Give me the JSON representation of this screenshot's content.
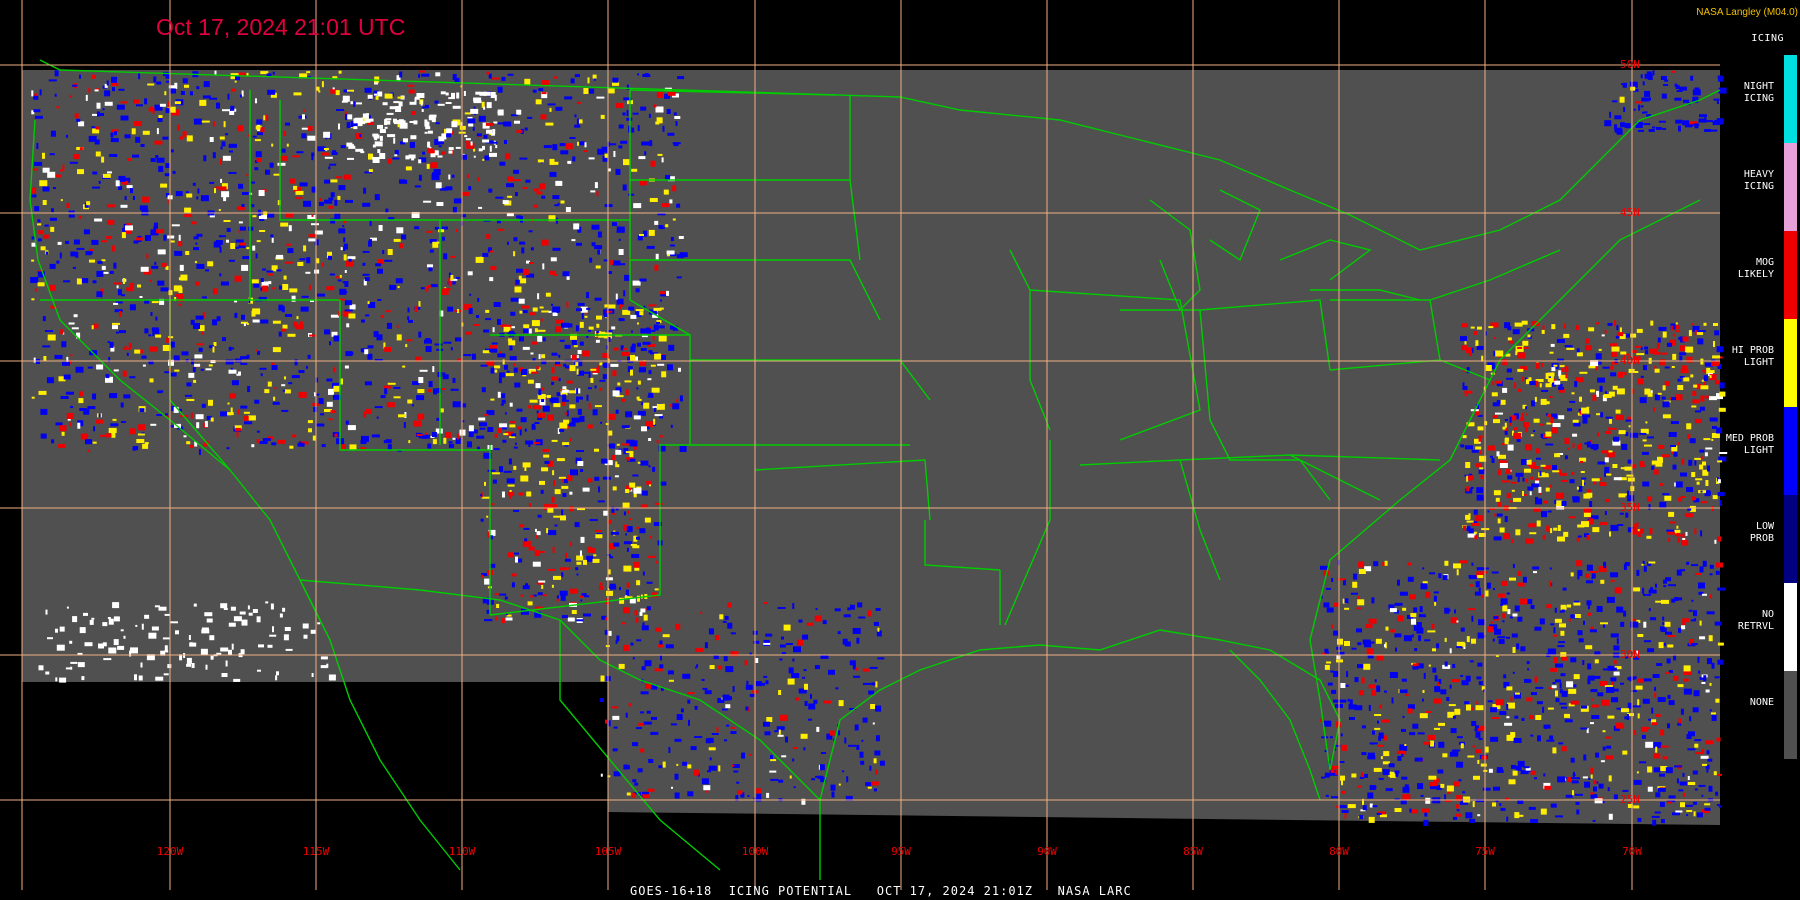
{
  "header": {
    "timestamp": "Oct 17, 2024 21:01 UTC",
    "credit": "NASA Langley (M04.0)"
  },
  "footer": {
    "product_title": "GOES-16+18  ICING POTENTIAL   OCT 17, 2024 21:01Z   NASA LARC"
  },
  "legend": {
    "title": "ICING",
    "items": [
      {
        "label": "NIGHT\nICING",
        "color": "#00e0e0"
      },
      {
        "label": "HEAVY\nICING",
        "color": "#e8a0d8"
      },
      {
        "label": "MOG\nLIKELY",
        "color": "#ee0000"
      },
      {
        "label": "HI PROB\nLIGHT",
        "color": "#ffff00"
      },
      {
        "label": "MED PROB\nLIGHT",
        "color": "#0000ff"
      },
      {
        "label": "LOW\nPROB",
        "color": "#000080"
      },
      {
        "label": "NO\nRETRVL",
        "color": "#ffffff"
      },
      {
        "label": "NONE",
        "color": "#505050"
      }
    ]
  },
  "graticule": {
    "longitude_labels": [
      "120W",
      "115W",
      "110W",
      "105W",
      "100W",
      "95W",
      "90W",
      "85W",
      "80W",
      "75W",
      "70W"
    ],
    "latitude_labels": [
      "50N",
      "45N",
      "40N",
      "35N",
      "30N",
      "25N"
    ],
    "line_color": "#f0b080"
  },
  "colors": {
    "no_data": "#000000",
    "none": "#505050",
    "borders": "#00cc00"
  }
}
